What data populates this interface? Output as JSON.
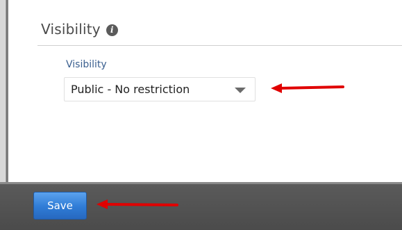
{
  "section": {
    "title": "Visibility",
    "info_icon": "info-icon"
  },
  "visibility_field": {
    "label": "Visibility",
    "selected_value": "Public - No restriction"
  },
  "footer": {
    "save_label": "Save"
  },
  "colors": {
    "annotation_arrow": "#e00000",
    "save_button": "#2f7cd6",
    "field_label": "#3a5f8f",
    "footer_bar": "#4b4b4b"
  }
}
